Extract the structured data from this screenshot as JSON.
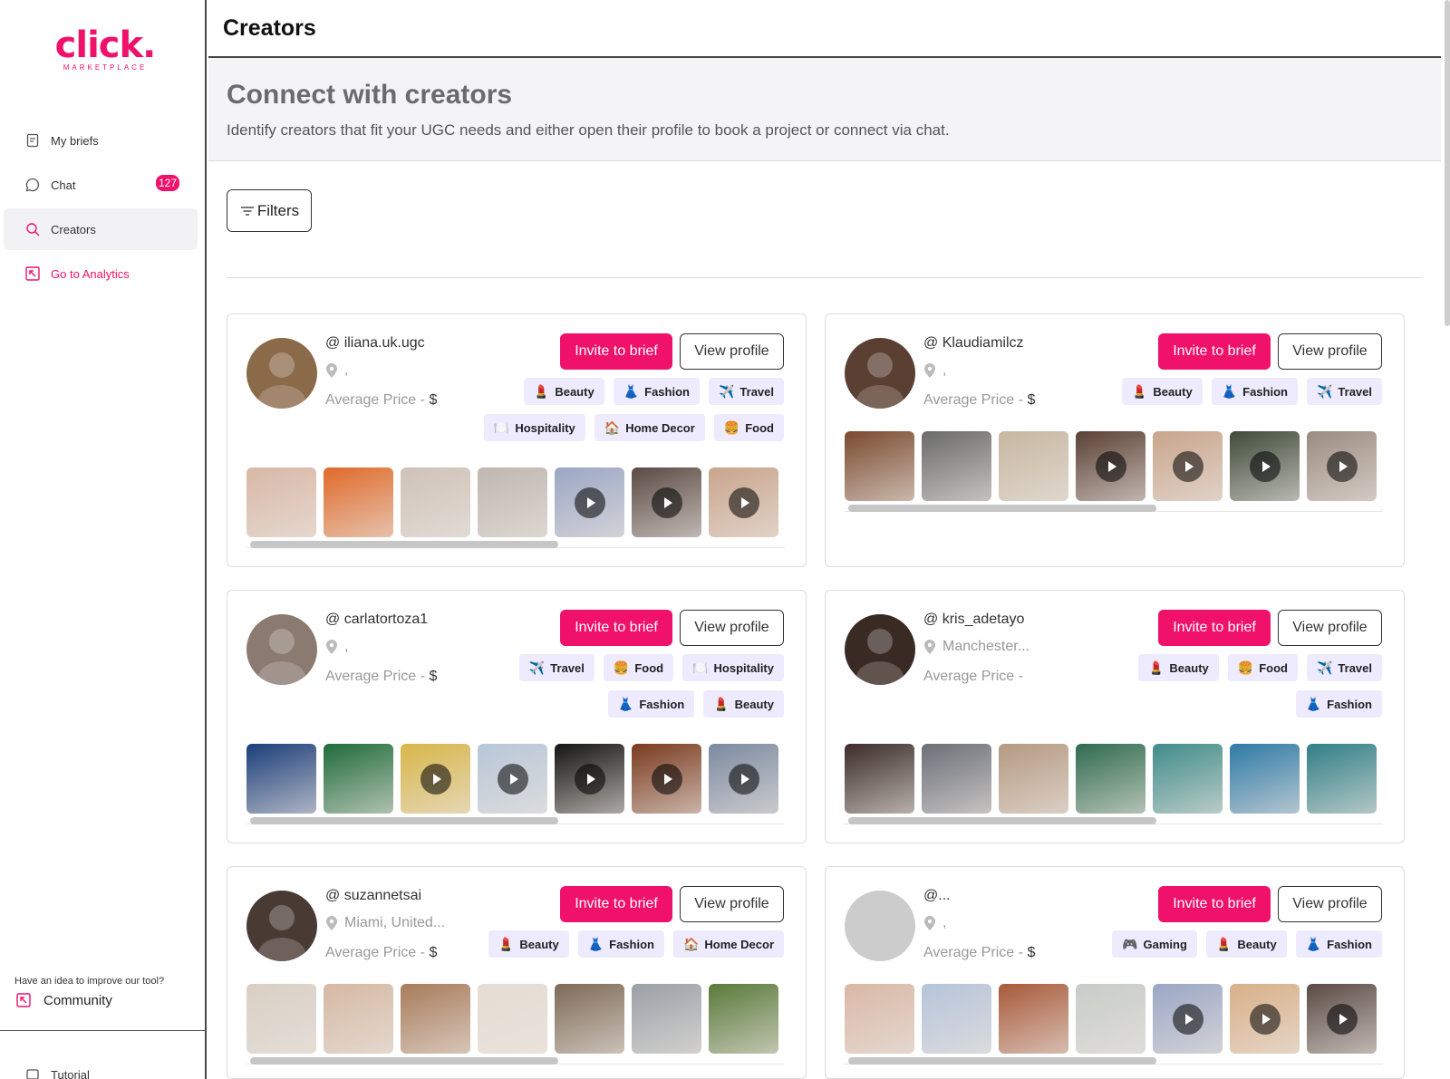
{
  "brand": {
    "name": "click.",
    "sub": "MARKETPLACE",
    "color": "#f0116a"
  },
  "sidebar": {
    "items": [
      {
        "label": "My briefs",
        "icon": "brief-icon"
      },
      {
        "label": "Chat",
        "icon": "chat-icon",
        "badge": "127"
      },
      {
        "label": "Creators",
        "icon": "search-icon",
        "active": true
      },
      {
        "label": "Go to Analytics",
        "icon": "analytics-arrow-icon"
      }
    ],
    "idea_text": "Have an idea to improve our tool?",
    "community_label": "Community",
    "tutorial_label": "Tutorial"
  },
  "header": {
    "title": "Creators"
  },
  "hero": {
    "title": "Connect with creators",
    "subtitle": "Identify creators that fit your UGC needs and either open their profile to book a project or connect via chat."
  },
  "filters_label": "Filters",
  "card_labels": {
    "invite": "Invite to brief",
    "view": "View profile",
    "price_prefix": "Average Price -"
  },
  "creators": [
    {
      "handle": "@ iliana.uk.ugc",
      "location": ",",
      "currency": "$",
      "tags": [
        {
          "emoji": "lipstick-icon",
          "label": "Beauty"
        },
        {
          "emoji": "dress-icon",
          "label": "Fashion"
        },
        {
          "emoji": "plane-icon",
          "label": "Travel"
        },
        {
          "emoji": "plate-icon",
          "label": "Hospitality"
        },
        {
          "emoji": "house-icon",
          "label": "Home Decor"
        },
        {
          "emoji": "burger-icon",
          "label": "Food"
        }
      ],
      "thumbs": [
        {
          "video": false
        },
        {
          "video": false
        },
        {
          "video": false
        },
        {
          "video": false
        },
        {
          "video": true
        },
        {
          "video": true
        },
        {
          "video": true
        }
      ]
    },
    {
      "handle": "@ Klaudiamilcz",
      "location": ",",
      "currency": "$",
      "tags": [
        {
          "emoji": "lipstick-icon",
          "label": "Beauty"
        },
        {
          "emoji": "dress-icon",
          "label": "Fashion"
        },
        {
          "emoji": "plane-icon",
          "label": "Travel"
        }
      ],
      "thumbs": [
        {
          "video": false
        },
        {
          "video": false
        },
        {
          "video": false
        },
        {
          "video": true
        },
        {
          "video": true
        },
        {
          "video": true
        },
        {
          "video": true
        }
      ]
    },
    {
      "handle": "@ carlatortoza1",
      "location": ",",
      "currency": "$",
      "tags": [
        {
          "emoji": "plane-icon",
          "label": "Travel"
        },
        {
          "emoji": "burger-icon",
          "label": "Food"
        },
        {
          "emoji": "plate-icon",
          "label": "Hospitality"
        },
        {
          "emoji": "dress-icon",
          "label": "Fashion"
        },
        {
          "emoji": "lipstick-icon",
          "label": "Beauty"
        }
      ],
      "thumbs": [
        {
          "video": false
        },
        {
          "video": false
        },
        {
          "video": true
        },
        {
          "video": true
        },
        {
          "video": true
        },
        {
          "video": true
        },
        {
          "video": true
        }
      ]
    },
    {
      "handle": "@ kris_adetayo",
      "location": "Manchester...",
      "currency": "",
      "tags": [
        {
          "emoji": "lipstick-icon",
          "label": "Beauty"
        },
        {
          "emoji": "burger-icon",
          "label": "Food"
        },
        {
          "emoji": "plane-icon",
          "label": "Travel"
        },
        {
          "emoji": "dress-icon",
          "label": "Fashion"
        }
      ],
      "thumbs": [
        {
          "video": false
        },
        {
          "video": false
        },
        {
          "video": false
        },
        {
          "video": false
        },
        {
          "video": false
        },
        {
          "video": false
        },
        {
          "video": false
        }
      ]
    },
    {
      "handle": "@ suzannetsai",
      "location": "Miami, United...",
      "currency": "$",
      "tags": [
        {
          "emoji": "lipstick-icon",
          "label": "Beauty"
        },
        {
          "emoji": "dress-icon",
          "label": "Fashion"
        },
        {
          "emoji": "house-icon",
          "label": "Home Decor"
        }
      ],
      "thumbs": [
        {
          "video": false
        },
        {
          "video": false
        },
        {
          "video": false
        },
        {
          "video": false
        },
        {
          "video": false
        },
        {
          "video": false
        },
        {
          "video": false
        }
      ]
    },
    {
      "handle": "@...",
      "location": ",",
      "currency": "$",
      "tags": [
        {
          "emoji": "gamepad-icon",
          "label": "Gaming"
        },
        {
          "emoji": "lipstick-icon",
          "label": "Beauty"
        },
        {
          "emoji": "dress-icon",
          "label": "Fashion"
        }
      ],
      "thumbs": [
        {
          "video": false
        },
        {
          "video": false
        },
        {
          "video": false
        },
        {
          "video": false
        },
        {
          "video": true
        },
        {
          "video": true
        },
        {
          "video": true
        }
      ]
    }
  ]
}
